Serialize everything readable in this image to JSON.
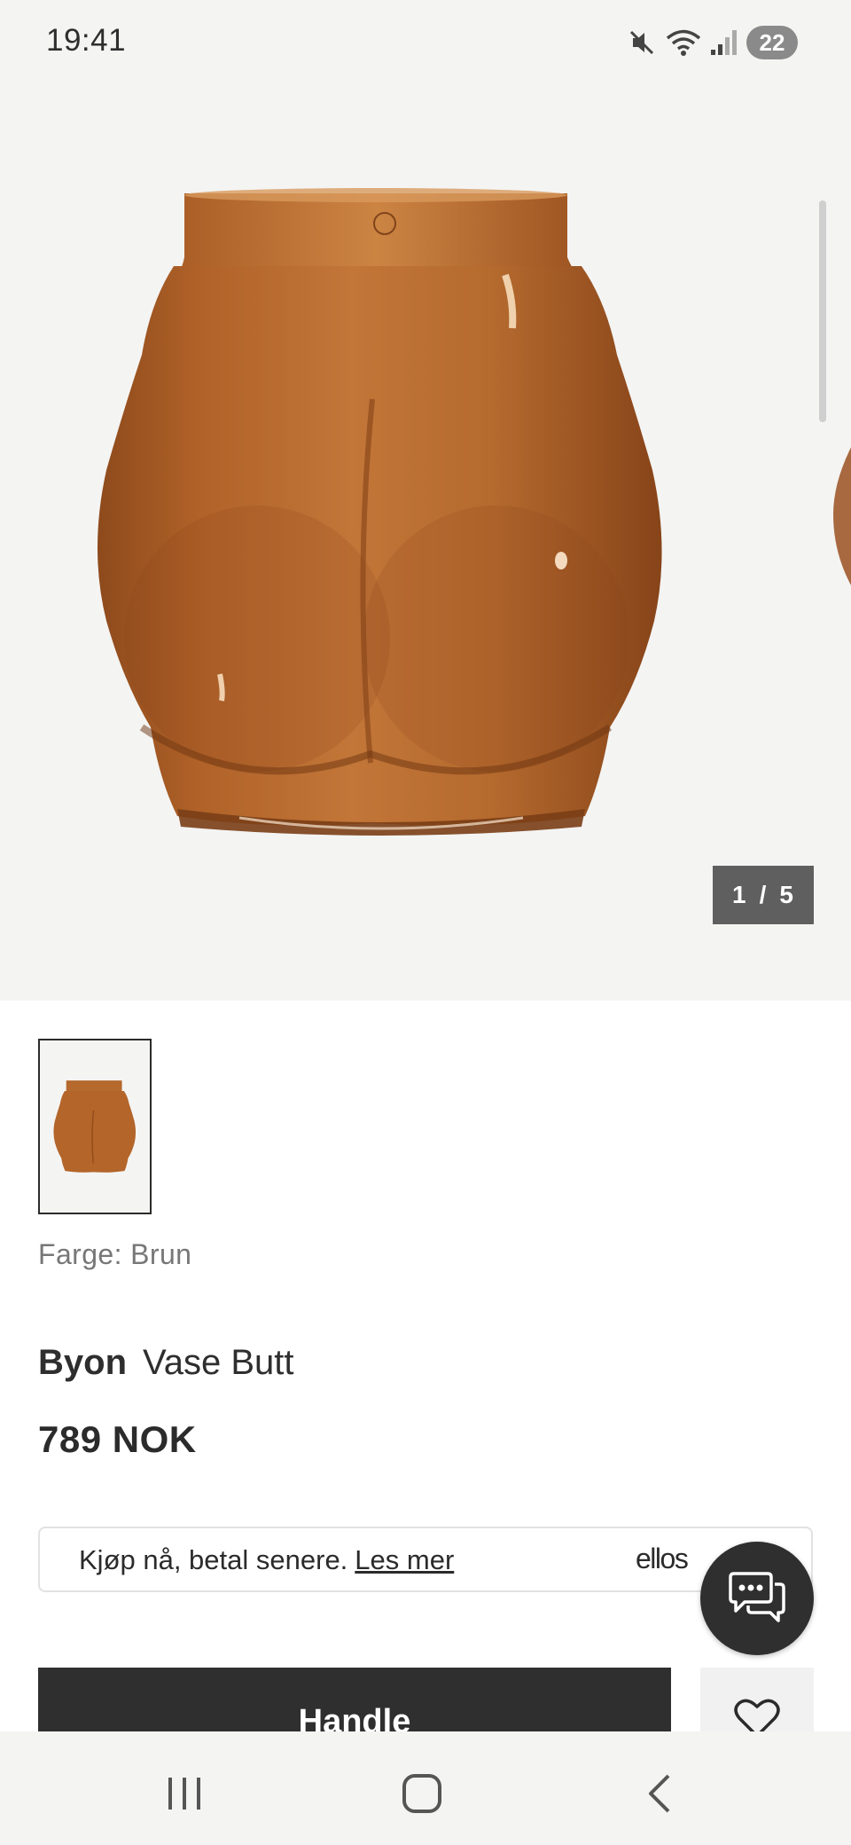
{
  "status_bar": {
    "time": "19:41",
    "battery": "22",
    "icons": [
      "mute-icon",
      "wifi-icon",
      "signal-icon"
    ]
  },
  "gallery": {
    "current": "1",
    "separator": "/",
    "total": "5",
    "image": "vase-butt-brown"
  },
  "product": {
    "color_label": "Farge: Brun",
    "brand": "Byon",
    "name": "Vase Butt",
    "price": "789 NOK"
  },
  "paylater": {
    "text": "Kjøp nå, betal senere.",
    "link": "Les mer",
    "brand": "ellos"
  },
  "actions": {
    "buy_label": "Handle"
  },
  "colors": {
    "dark": "#2f2f2f",
    "gallery_bg": "#f4f4f3",
    "vase": "#b3652a"
  }
}
